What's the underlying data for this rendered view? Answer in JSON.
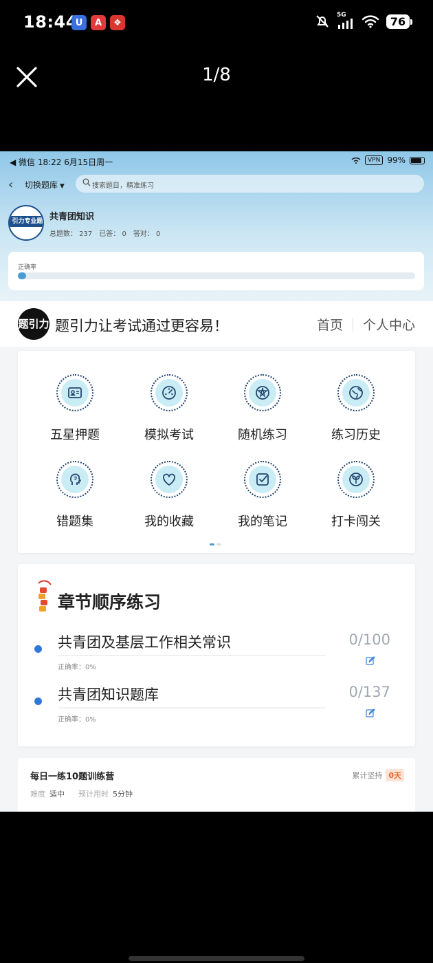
{
  "phone_status": {
    "time": "18:44",
    "network": "5G",
    "battery": "76",
    "apps": [
      {
        "icon": "blue-app-icon",
        "glyph": "U",
        "color": "#3b6fe0"
      },
      {
        "icon": "red-triangle-app-icon",
        "glyph": "A",
        "color": "#e03b3b"
      },
      {
        "icon": "red-pattern-app-icon",
        "glyph": "❖",
        "color": "#d9362f"
      }
    ]
  },
  "viewer": {
    "counter": "1/8"
  },
  "inner_status": {
    "left": "◀ 微信   18:22   6月15日周一",
    "vpn": "VPN",
    "battery": "99%"
  },
  "nav": {
    "switch_bank": "切换题库",
    "search_placeholder": "搜索题目，精准练习"
  },
  "bank": {
    "logo_text": "引力专业题",
    "name": "共青团知识",
    "stats": [
      "总题数： 237",
      "已答： 0",
      "答对： 0"
    ],
    "accuracy_label": "正确率",
    "accuracy_value": 0.02
  },
  "brand": {
    "logo_text": "题引力",
    "slogan": "题引力让考试通过更容易！",
    "links": [
      "首页",
      "个人中心"
    ]
  },
  "features": [
    {
      "label": "五星押题",
      "icon": "id-card-icon"
    },
    {
      "label": "模拟考试",
      "icon": "gauge-icon"
    },
    {
      "label": "随机练习",
      "icon": "random-icon"
    },
    {
      "label": "练习历史",
      "icon": "history-globe-icon"
    },
    {
      "label": "错题集",
      "icon": "head-icon"
    },
    {
      "label": "我的收藏",
      "icon": "heart-icon"
    },
    {
      "label": "我的笔记",
      "icon": "note-check-icon"
    },
    {
      "label": "打卡闯关",
      "icon": "leaf-badge-icon"
    }
  ],
  "chapters": {
    "title": "章节顺序练习",
    "items": [
      {
        "name": "共青团及基层工作相关常识",
        "accuracy": "正确率：0%",
        "progress": "0/100"
      },
      {
        "name": "共青团知识题库",
        "accuracy": "正确率：0%",
        "progress": "0/137"
      }
    ]
  },
  "daily": {
    "title": "每日一练10题训练营",
    "streak_label": "累计坚持",
    "streak_value": "0天",
    "difficulty_label": "难度",
    "difficulty_value": "适中",
    "time_label": "预计用时",
    "time_value": "5分钟"
  }
}
